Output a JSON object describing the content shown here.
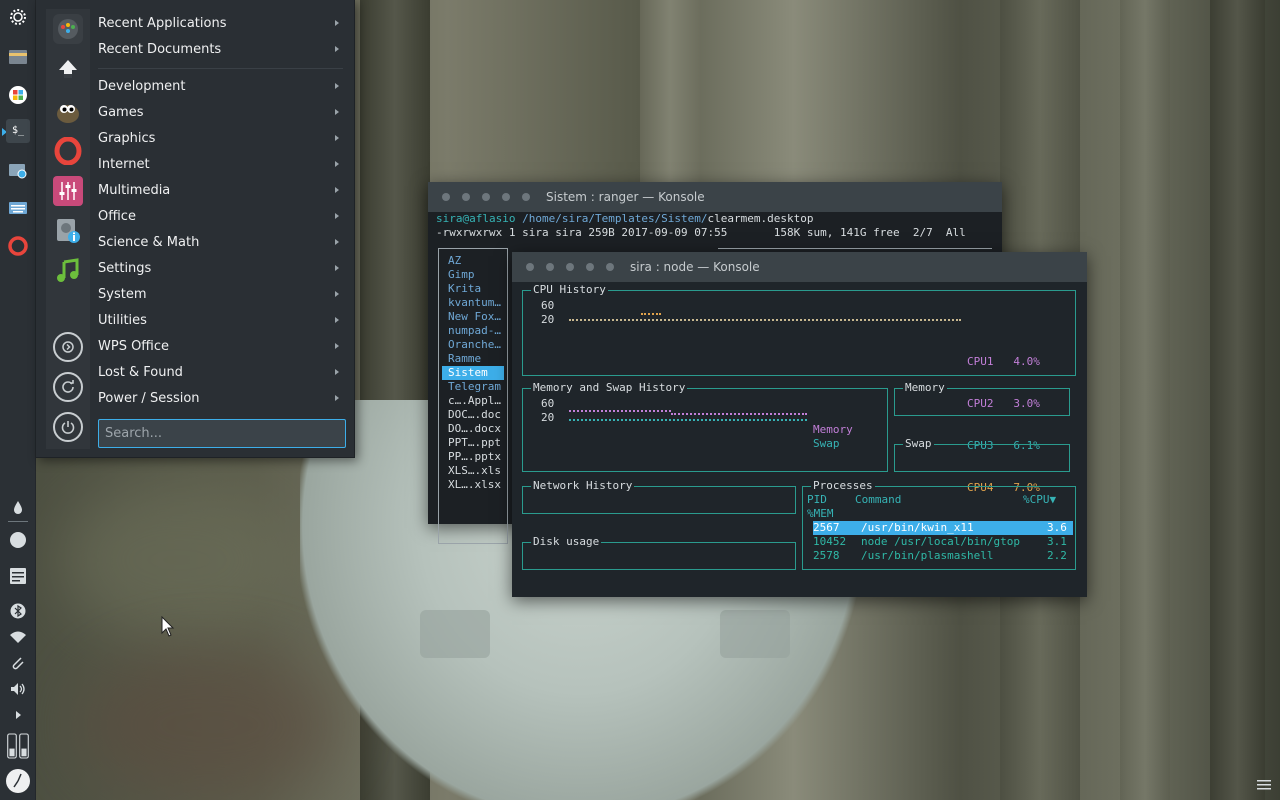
{
  "launcher": {
    "menu": [
      {
        "label": "Recent Applications"
      },
      {
        "label": "Recent Documents"
      },
      {
        "label": "Development"
      },
      {
        "label": "Games"
      },
      {
        "label": "Graphics"
      },
      {
        "label": "Internet"
      },
      {
        "label": "Multimedia"
      },
      {
        "label": "Office"
      },
      {
        "label": "Science & Math"
      },
      {
        "label": "Settings"
      },
      {
        "label": "System"
      },
      {
        "label": "Utilities"
      },
      {
        "label": "WPS Office"
      },
      {
        "label": "Lost & Found"
      },
      {
        "label": "Power / Session"
      }
    ],
    "search_placeholder": "Search...",
    "favorites": [
      "chrome-icon",
      "inkscape-icon",
      "gimp-icon",
      "opera-icon",
      "mixer-icon",
      "disk-info-icon",
      "music-icon"
    ],
    "power_icons": [
      "switch-user-icon",
      "restart-icon",
      "shutdown-icon"
    ]
  },
  "panel": {
    "icons": [
      "kde-logo-icon",
      "file-manager-icon",
      "store-icon",
      "terminal-icon",
      "screenshot-icon",
      "keyboard-icon",
      "opera-icon",
      "drop-icon",
      "circle-icon",
      "notes-icon",
      "bluetooth-icon",
      "wifi-icon",
      "clip-icon",
      "volume-icon",
      "expand-icon",
      "battery-icon",
      "clock-icon"
    ],
    "terminal_glyph": "$_"
  },
  "ranger": {
    "title": "Sistem : ranger — Konsole",
    "prompt_user": "sira@aflasio",
    "prompt_path": "/home/sira/Templates/Sistem/",
    "prompt_file": "clearmem.desktop",
    "status_line": "-rwxrwxrwx 1 sira sira 259B 2017-09-09 07:55       158K sum, 141G free  2/7  All",
    "files": [
      "AZ",
      "Gimp",
      "Krita",
      "kvantum…",
      "New Fox…",
      "numpad-…",
      "Oranche…",
      "Ramme",
      "Sistem",
      "Telegram",
      "c….Appl…",
      "DOC….doc",
      "DO….docx",
      "PPT….ppt",
      "PP….pptx",
      "XLS….xls",
      "XL….xlsx"
    ],
    "selected_file": "Sistem"
  },
  "gtop": {
    "title": "sira : node — Konsole",
    "cpu": {
      "title": "CPU History",
      "y_ticks": [
        "60",
        "20"
      ],
      "legend": [
        {
          "name": "CPU1",
          "value": "4.0%",
          "color": "#c27fd8"
        },
        {
          "name": "CPU2",
          "value": "3.0%",
          "color": "#c27fd8"
        },
        {
          "name": "CPU3",
          "value": "6.1%",
          "color": "#36b3b5"
        },
        {
          "name": "CPU4",
          "value": "7.0%",
          "color": "#e0a24b"
        }
      ]
    },
    "memswap": {
      "title": "Memory and Swap History",
      "y_ticks": [
        "60",
        "20"
      ],
      "legend_memory": "Memory",
      "legend_swap": "Swap"
    },
    "memory_title": "Memory",
    "swap_title": "Swap",
    "network_title": "Network History",
    "disk_title": "Disk usage",
    "processes": {
      "title": "Processes",
      "headers": {
        "pid": "PID",
        "command": "Command",
        "cpu": "%CPU▼",
        "mem": "%MEM"
      },
      "rows": [
        {
          "pid": "2567",
          "command": "/usr/bin/kwin_x11",
          "cpu": "3.6",
          "selected": true
        },
        {
          "pid": "10452",
          "command": "node /usr/local/bin/gtop",
          "cpu": "3.1",
          "selected": false
        },
        {
          "pid": "2578",
          "command": "/usr/bin/plasmashell",
          "cpu": "2.2",
          "selected": false
        }
      ]
    }
  }
}
